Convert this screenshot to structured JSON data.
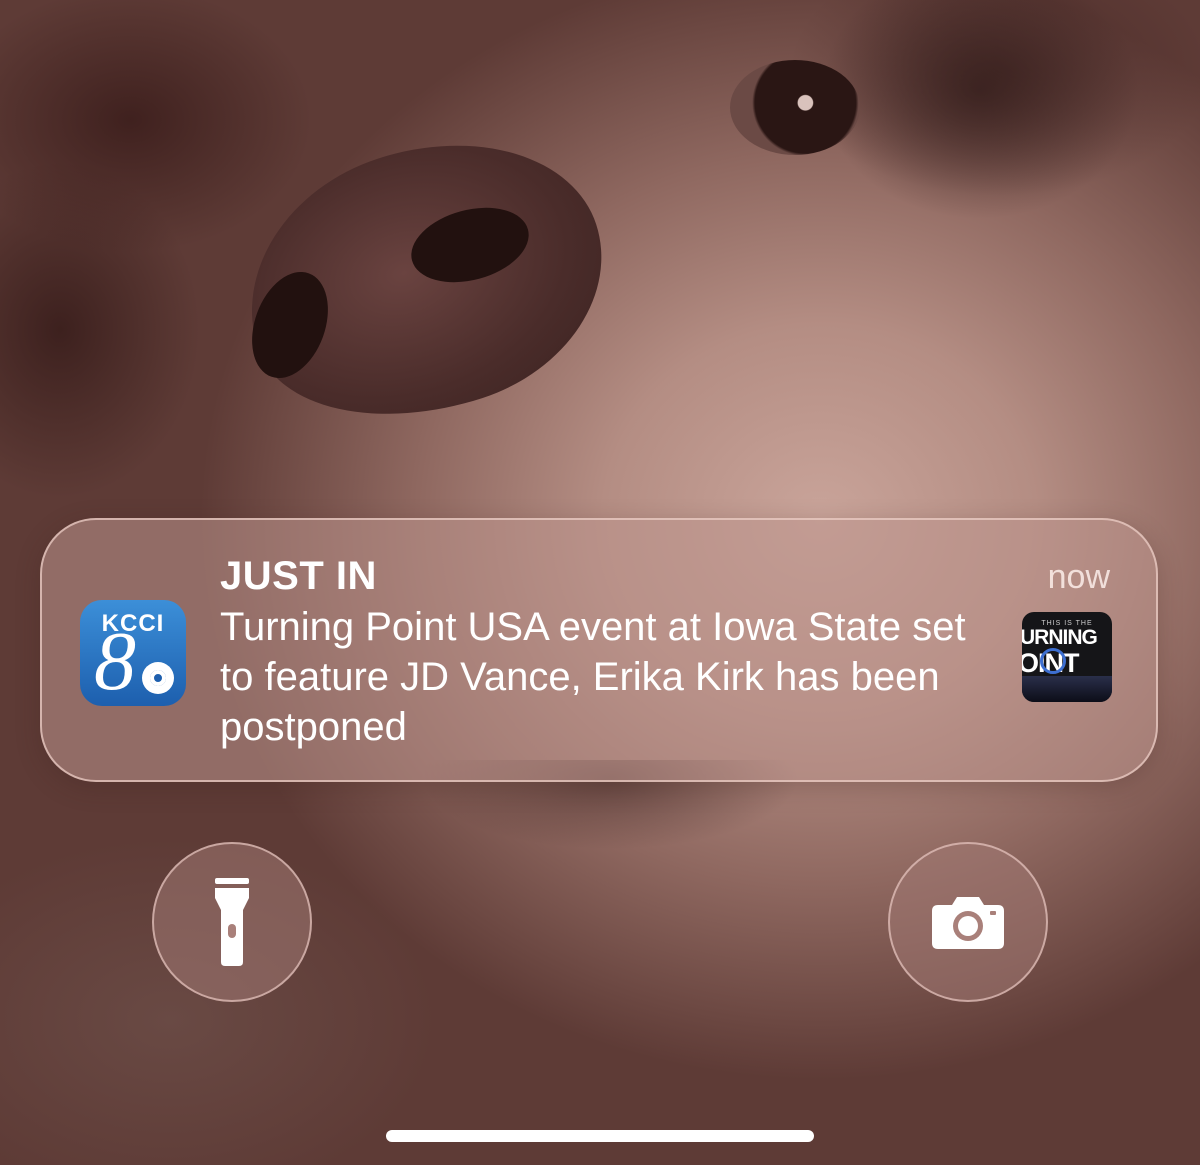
{
  "notification": {
    "app_icon": "kcci-8-app-icon",
    "app_icon_text": "KCCI",
    "app_icon_numeral": "8",
    "title": "JUST IN",
    "body": "Turning Point USA event at Iowa State set to feature JD Vance, Erika Kirk has been postponed",
    "time": "now",
    "thumbnail": {
      "small_text": "THIS IS THE",
      "line1": "URNING",
      "line2": "OINT"
    }
  },
  "lock_screen": {
    "flashlight_icon": "flashlight-icon",
    "camera_icon": "camera-icon"
  },
  "colors": {
    "wallpaper_tint": "#b48d83",
    "notification_bg": "#be968e",
    "app_icon_blue": "#1d5fae"
  }
}
